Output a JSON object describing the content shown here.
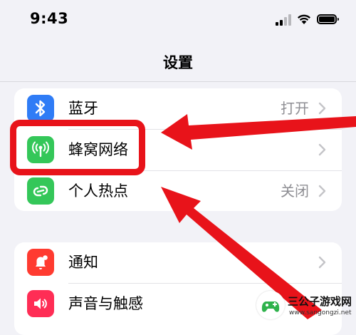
{
  "status_bar": {
    "time": "9:43"
  },
  "nav": {
    "title": "设置"
  },
  "group1": {
    "rows": [
      {
        "label": "蓝牙",
        "value": "打开",
        "icon": "bluetooth-icon",
        "icon_color": "#2f7cf6"
      },
      {
        "label": "蜂窝网络",
        "value": "",
        "icon": "cellular-antenna-icon",
        "icon_color": "#34c759"
      },
      {
        "label": "个人热点",
        "value": "关闭",
        "icon": "hotspot-link-icon",
        "icon_color": "#34c759"
      }
    ]
  },
  "group2": {
    "rows": [
      {
        "label": "通知",
        "icon": "bell-icon",
        "icon_color": "#ff3b30"
      },
      {
        "label": "声音与触感",
        "icon": "speaker-icon",
        "icon_color": "#ff2d55"
      }
    ]
  },
  "annotation": {
    "highlight_color": "#e8131a"
  },
  "watermark": {
    "title": "三公子游戏网",
    "url": "www.sangongzi.net"
  }
}
